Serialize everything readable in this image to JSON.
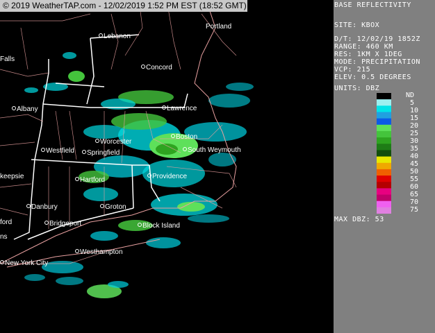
{
  "banner": "© 2019 WeatherTAP.com - 12/02/2019  1:52 PM EST (18:52 GMT)",
  "cities": [
    {
      "name": "Lebanon",
      "dot": true
    },
    {
      "name": "Portland",
      "dot": false
    },
    {
      "name": "Falls",
      "dot": false
    },
    {
      "name": "Concord",
      "dot": true
    },
    {
      "name": "Albany",
      "dot": true
    },
    {
      "name": "Lawrence",
      "dot": true
    },
    {
      "name": "Boston",
      "dot": true
    },
    {
      "name": "Worcester",
      "dot": true
    },
    {
      "name": "Westfield",
      "dot": true
    },
    {
      "name": "Springfield",
      "dot": true
    },
    {
      "name": "South Weymouth",
      "dot": true
    },
    {
      "name": "keepsie",
      "dot": false
    },
    {
      "name": "Hartford",
      "dot": true
    },
    {
      "name": "Providence",
      "dot": true
    },
    {
      "name": "Danbury",
      "dot": true
    },
    {
      "name": "Groton",
      "dot": true
    },
    {
      "name": "ford",
      "dot": false
    },
    {
      "name": "Bridgeport",
      "dot": true
    },
    {
      "name": "Block Island",
      "dot": true
    },
    {
      "name": "ns",
      "dot": false
    },
    {
      "name": "Westhampton",
      "dot": true
    },
    {
      "name": "New York City",
      "dot": true
    }
  ],
  "panel": {
    "title": "BASE REFLECTIVITY",
    "site": "SITE:  KBOX",
    "dt": "D/T:   12/02/19 1852Z",
    "range": "RANGE: 460 KM",
    "res": "RES:   1KM X 1DEG",
    "mode": "MODE:  PRECIPITATION",
    "vcp": "VCP:   215",
    "elev": "ELEV:  0.5 DEGREES",
    "units": "UNITS: DBZ",
    "max": "MAX DBZ:  53"
  },
  "legend": {
    "levels": [
      "ND",
      "5",
      "10",
      "15",
      "20",
      "25",
      "30",
      "35",
      "40",
      "45",
      "50",
      "55",
      "60",
      "65",
      "70",
      "75"
    ],
    "colors": [
      "#000000",
      "#9cf0f0",
      "#00e4e8",
      "#20a0e0",
      "#0c5ae8",
      "#5ee05a",
      "#44c43c",
      "#2ea420",
      "#1e7c16",
      "#124e0c",
      "#e8e800",
      "#f0a800",
      "#f06000",
      "#e00000",
      "#b40000",
      "#e80080",
      "#c0006a",
      "#f060f0",
      "#e080e0"
    ]
  }
}
